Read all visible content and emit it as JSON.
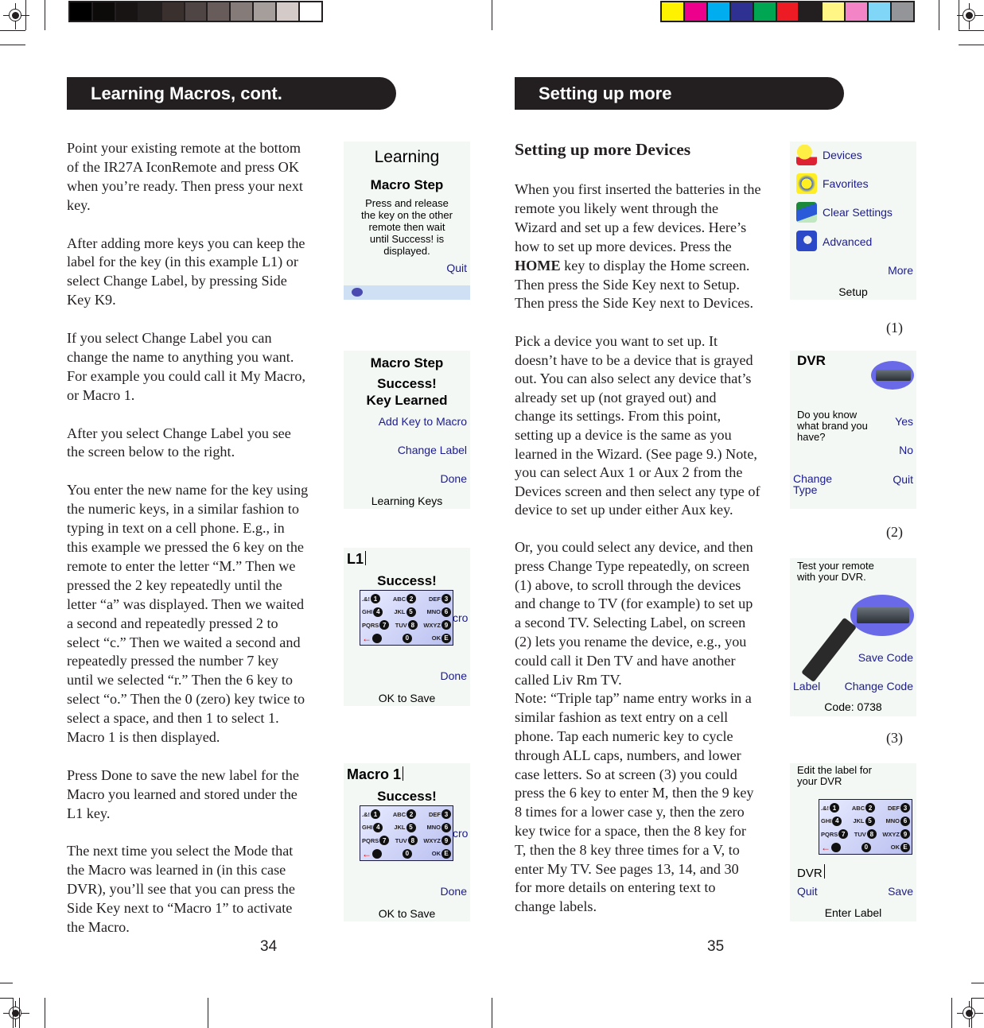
{
  "print_marks": {
    "grayscale_swatches": [
      "#000000",
      "#0d0b0a",
      "#181413",
      "#231f1e",
      "#3a302e",
      "#4e4544",
      "#675c5a",
      "#857b79",
      "#a69e9b",
      "#d4cbc9",
      "#ffffff"
    ],
    "color_swatches": [
      "#fff200",
      "#ec008c",
      "#00aeef",
      "#2e3192",
      "#00a651",
      "#ed1c24",
      "#231f20",
      "#fff685",
      "#f384c6",
      "#7fd6f7",
      "#939598"
    ]
  },
  "left_page": {
    "section_title": "Learning Macros, cont.",
    "paragraphs": [
      "Point your existing remote at the bottom\nof the IR27A IconRemote and press OK\nwhen you’re ready. Then press your next\nkey.",
      "After adding more keys you can keep the\nlabel for the key (in this example L1) or\nselect Change Label, by pressing Side\nKey K9.",
      "If you select Change Label you can\nchange the name to anything you want.\nFor example you could call it My Macro,\nor Macro 1.",
      "After you select Change Label you see\nthe screen below to the right.",
      "You enter the new name for the key using\nthe numeric keys, in a similar fashion to\ntyping in text on a cell phone. E.g., in\nthis example we pressed the 6 key on the\nremote to enter the letter “M.” Then we\npressed the 2 key repeatedly until the\nletter “a” was displayed. Then we waited\na second and repeatedly pressed 2 to\nselect “c.” Then we waited a second and\nrepeatedly pressed the number 7 key\nuntil we selected “r.” Then the 6 key to\nselect “o.” Then the 0 (zero) key twice to\nselect a space, and then 1 to select 1.\nMacro 1 is then displayed.",
      "Press Done to save the new label for the\nMacro you learned and stored under the\nL1 key.",
      "The next time you select the Mode that\nthe Macro was learned in (in this case\nDVR), you’ll see that you can press the\nSide Key next to “Macro 1” to activate\nthe Macro."
    ],
    "page_number": "34",
    "screens": {
      "learning": {
        "title": "Learning",
        "subtitle": "Macro Step",
        "message": "Press and release\nthe key on the other\nremote then wait\nuntil Success! is\ndisplayed.",
        "quit": "Quit"
      },
      "key_learned": {
        "line1": "Macro Step",
        "line2": "Success!",
        "line3": "Key Learned",
        "add_key": "Add Key to Macro",
        "change_label": "Change Label",
        "done": "Done",
        "footer": "Learning Keys"
      },
      "label_l1": {
        "label_value": "L1",
        "status": "Success!",
        "partial_behind": "cro",
        "done": "Done",
        "footer": "OK to Save"
      },
      "label_macro1": {
        "label_value": "Macro 1",
        "status": "Success!",
        "partial_behind": "cro",
        "done": "Done",
        "footer": "OK to Save"
      }
    }
  },
  "keypad": {
    "rows": [
      [
        {
          "letters": ".&!",
          "key": "1"
        },
        {
          "letters": "ABC",
          "key": "2"
        },
        {
          "letters": "DEF",
          "key": "3"
        }
      ],
      [
        {
          "letters": "GHI",
          "key": "4"
        },
        {
          "letters": "JKL",
          "key": "5"
        },
        {
          "letters": "MNO",
          "key": "6"
        }
      ],
      [
        {
          "letters": "PQRS",
          "key": "7"
        },
        {
          "letters": "TUV",
          "key": "8"
        },
        {
          "letters": "WXYZ",
          "key": "9"
        }
      ],
      [
        {
          "letters": "←",
          "key": ""
        },
        {
          "letters": "",
          "key": "0"
        },
        {
          "letters": "OK",
          "key": "E"
        }
      ]
    ]
  },
  "right_page": {
    "section_title": "Setting up more",
    "heading": "Setting up more Devices",
    "para1_pre": "When you first inserted the batteries in the\nremote you likely went through the\nWizard and set up a few devices. Here’s\nhow to set up more devices. Press the\n",
    "para1_bold": "HOME",
    "para1_post": " key to display the Home screen.\nThen press the Side Key next to Setup.\nThen press the Side Key next to Devices.",
    "paragraphs": [
      "Pick a device you want to set up. It\ndoesn’t have to be a device that is grayed\nout. You can also select any device that’s\nalready set up (not grayed out) and\nchange its settings. From this point,\nsetting up a device is the same as you\nlearned in the Wizard. (See page 9.) Note,\nyou can select Aux 1 or Aux 2 from the\nDevices screen and then select any type of\ndevice to set up under either Aux key.",
      "Or, you could select any device, and then\npress Change Type repeatedly, on screen\n(1) above, to scroll through the devices\nand change to TV (for example) to set up\na second TV. Selecting Label, on screen\n(2) lets you rename the device, e.g., you\ncould call it Den TV and have another\ncalled Liv Rm TV.\nNote: “Triple tap” name entry works in a\nsimilar fashion as text entry on a cell\nphone. Tap each numeric key to cycle\nthrough ALL caps, numbers, and lower\ncase letters. So at screen (3) you could\npress the 6 key to enter M, then the 9 key\n8 times for a lower case y, then the zero\nkey twice for a space, then the 8 key for\nT, then the 8 key three times for a V, to\nenter My TV. See pages 13, 14, and 30\nfor more details on entering text to\nchange labels."
    ],
    "page_number": "35",
    "screen_refs": [
      "(1)",
      "(2)",
      "(3)"
    ],
    "screens": {
      "setup": {
        "items": [
          {
            "label": "Devices",
            "icon": "devices-icon"
          },
          {
            "label": "Favorites",
            "icon": "favorites-icon"
          },
          {
            "label": "Clear Settings",
            "icon": "clear-settings-icon"
          },
          {
            "label": "Advanced",
            "icon": "advanced-icon"
          }
        ],
        "more": "More",
        "footer": "Setup"
      },
      "dvr": {
        "title": "DVR",
        "question": "Do you know\nwhat brand you\nhave?",
        "yes": "Yes",
        "no": "No",
        "change_type": "Change\nType",
        "quit": "Quit"
      },
      "test": {
        "message": "Test your remote\nwith your DVR.",
        "save_code": "Save Code",
        "label": "Label",
        "change_code": "Change Code",
        "code": "Code: 0738"
      },
      "edit_label": {
        "message": "Edit the label for\nyour DVR",
        "label_value": "DVR",
        "quit": "Quit",
        "save": "Save",
        "footer": "Enter Label"
      }
    }
  }
}
